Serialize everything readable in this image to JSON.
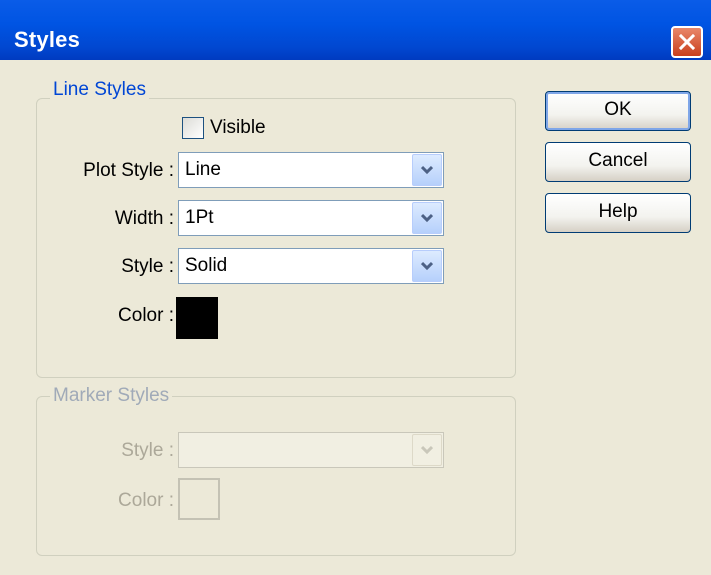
{
  "window": {
    "title": "Styles"
  },
  "line_styles": {
    "legend": "Line Styles",
    "visible_label": "Visible",
    "visible_checked": false,
    "plot_style_label": "Plot Style :",
    "plot_style_value": "Line",
    "width_label": "Width :",
    "width_value": "1Pt",
    "style_label": "Style :",
    "style_value": "Solid",
    "color_label": "Color :",
    "color_value": "#000000"
  },
  "marker_styles": {
    "legend": "Marker Styles",
    "style_label": "Style :",
    "style_value": "",
    "color_label": "Color :",
    "color_value": "#ece9d8",
    "enabled": false
  },
  "buttons": {
    "ok": "OK",
    "cancel": "Cancel",
    "help": "Help"
  },
  "colors": {
    "titlebar": "#0054e3",
    "dialog_bg": "#ece9d8",
    "group_legend": "#0046d5",
    "disabled_text": "#aca899"
  }
}
